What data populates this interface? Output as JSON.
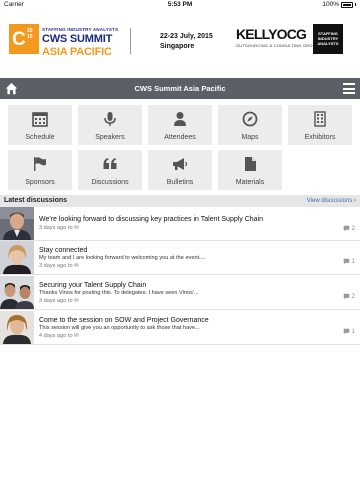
{
  "status_bar": {
    "carrier": "Carrier",
    "time": "5:53 PM",
    "battery": "100%"
  },
  "banner": {
    "logo_mark": "C",
    "logo_year_top": "20",
    "logo_year_bottom": "15",
    "supertitle": "STAFFING INDUSTRY ANALYSTS",
    "event_line1": "CWS SUMMIT",
    "event_line2": "ASIA PACIFIC",
    "dates": "22-23 July, 2015",
    "location": "Singapore",
    "sponsor_logo": "KELLYOCG",
    "sponsor_tagline": "OUTSOURCING & CONSULTING GROUP",
    "org_logo": "STAFFING INDUSTRY ANALYSTS"
  },
  "navbar": {
    "title": "CWS Summit Asia Pacific",
    "home_icon": "home-icon",
    "menu_icon": "hamburger-menu-icon"
  },
  "tiles": [
    {
      "label": "Schedule",
      "icon": "calendar-icon"
    },
    {
      "label": "Speakers",
      "icon": "microphone-icon"
    },
    {
      "label": "Attendees",
      "icon": "person-icon"
    },
    {
      "label": "Maps",
      "icon": "compass-icon"
    },
    {
      "label": "Exhibitors",
      "icon": "building-icon"
    },
    {
      "label": "Sponsors",
      "icon": "flag-icon"
    },
    {
      "label": "Discussions",
      "icon": "quote-icon"
    },
    {
      "label": "Bulletins",
      "icon": "megaphone-icon"
    },
    {
      "label": "Materials",
      "icon": "document-icon"
    }
  ],
  "discussions": {
    "header": "Latest discussions",
    "view_link": "View discussions ›",
    "items": [
      {
        "title": "We're looking forward to discussing key practices in Talent Supply Chain",
        "preview": "",
        "meta": "3 days ago to ✉",
        "count": "2"
      },
      {
        "title": "Stay connected",
        "preview": "My team and I are looking forward to welcoming you at the event....",
        "meta": "3 days ago to ✉",
        "count": "1"
      },
      {
        "title": "Securing your Talent Supply Chain",
        "preview": "Thanks Vinos for posting this. To delegates: I have seen Vinos'...",
        "meta": "3 days ago to ✉",
        "count": "2"
      },
      {
        "title": "Come to the session on SOW and Project Governance",
        "preview": "This session will give you an opportunity to ask those that have...",
        "meta": "4 days ago to ✉",
        "count": "1"
      }
    ]
  },
  "colors": {
    "navbar": "#5b5f66",
    "tile_bg": "#ececec",
    "accent_orange": "#f39a1e",
    "brand_navy": "#1b2a7b",
    "link": "#3b6cb3"
  }
}
